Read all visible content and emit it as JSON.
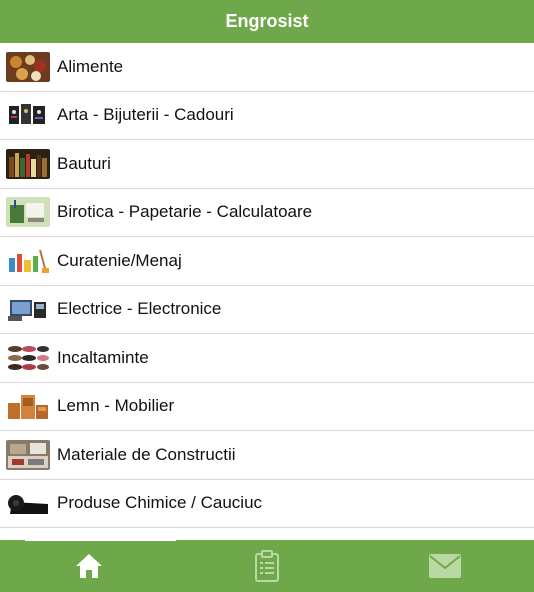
{
  "header": {
    "title": "Engrosist"
  },
  "categories": [
    {
      "label": "Alimente",
      "icon": "food-image"
    },
    {
      "label": "Arta - Bijuterii - Cadouri",
      "icon": "jewelry-image"
    },
    {
      "label": "Bauturi",
      "icon": "drinks-image"
    },
    {
      "label": "Birotica - Papetarie - Calculatoare",
      "icon": "office-supplies-image"
    },
    {
      "label": "Curatenie/Menaj",
      "icon": "cleaning-image"
    },
    {
      "label": "Electrice - Electronice",
      "icon": "electronics-image"
    },
    {
      "label": "Incaltaminte",
      "icon": "shoes-image"
    },
    {
      "label": "Lemn - Mobilier",
      "icon": "furniture-image"
    },
    {
      "label": "Materiale de Constructii",
      "icon": "construction-image"
    },
    {
      "label": "Produse Chimice / Cauciuc",
      "icon": "rubber-image"
    }
  ],
  "tabbar": {
    "tabs": [
      {
        "name": "home",
        "icon": "home-icon",
        "active": true
      },
      {
        "name": "orders",
        "icon": "clipboard-icon",
        "active": false
      },
      {
        "name": "messages",
        "icon": "envelope-icon",
        "active": false
      }
    ]
  },
  "colors": {
    "accent": "#6fa84b",
    "inactive_icon": "#b9d8a4"
  }
}
